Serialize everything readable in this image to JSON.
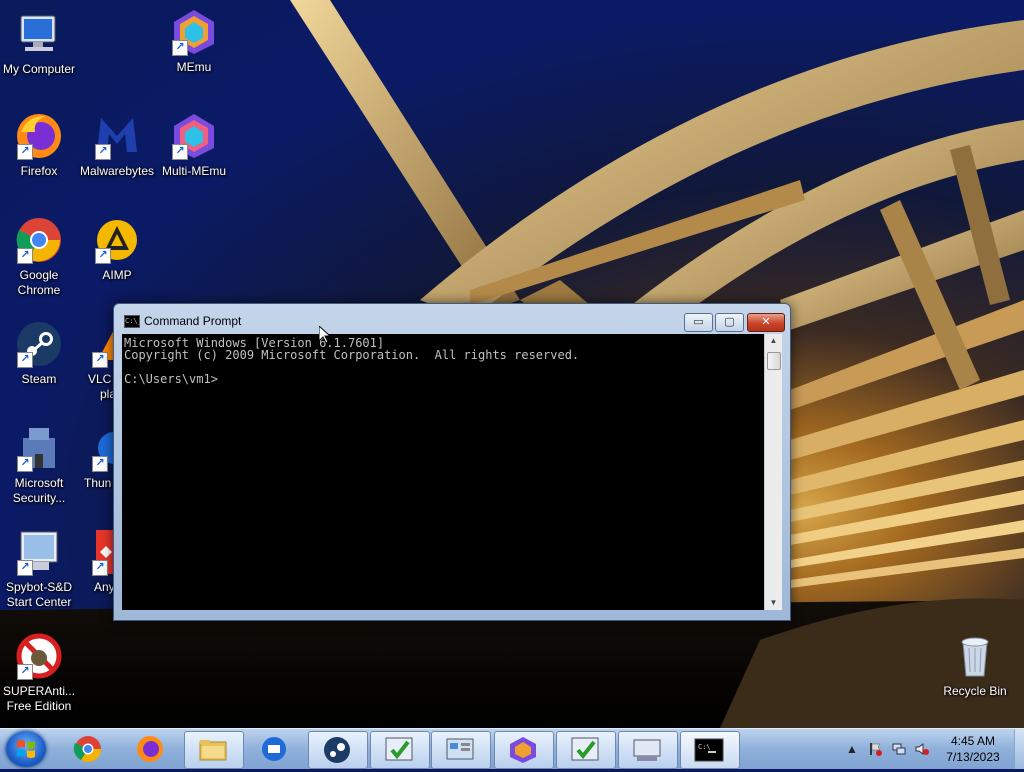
{
  "desktop": {
    "icons": [
      {
        "label": "My Computer",
        "icon": "computer-icon"
      },
      {
        "label": "MEmu",
        "icon": "memu-icon"
      },
      {
        "label": "Firefox",
        "icon": "firefox-icon"
      },
      {
        "label": "Malwarebytes",
        "icon": "malwarebytes-icon"
      },
      {
        "label": "Multi-MEmu",
        "icon": "multi-memu-icon"
      },
      {
        "label": "Google Chrome",
        "icon": "chrome-icon"
      },
      {
        "label": "AIMP",
        "icon": "aimp-icon"
      },
      {
        "label": "Steam",
        "icon": "steam-icon"
      },
      {
        "label": "VLC",
        "label2": "pla",
        "icon": "vlc-icon"
      },
      {
        "label": "Microsoft Security...",
        "icon": "microsoft-security-icon"
      },
      {
        "label": "Thun",
        "icon": "thunderbird-icon"
      },
      {
        "label": "Spybot-S&D Start Center",
        "icon": "spybot-icon"
      },
      {
        "label": "Any",
        "icon": "anydesk-icon"
      },
      {
        "label": "SUPERAnti... Free Edition",
        "icon": "superantispyware-icon"
      },
      {
        "label": "Recycle Bin",
        "icon": "recycle-bin-icon"
      }
    ]
  },
  "cmd": {
    "title": "Command Prompt",
    "icon_text": "C:\\_",
    "min_label": "▭",
    "max_label": "▢",
    "close_label": "✕",
    "lines": [
      "Microsoft Windows [Version 6.1.7601]",
      "Copyright (c) 2009 Microsoft Corporation.  All rights reserved.",
      "",
      "C:\\Users\\vm1>"
    ],
    "scroll_up": "▲",
    "scroll_down": "▼"
  },
  "taskbar": {
    "buttons": [
      {
        "name": "chrome",
        "icon": "chrome-icon",
        "open": false
      },
      {
        "name": "firefox",
        "icon": "firefox-icon",
        "open": false
      },
      {
        "name": "explorer",
        "icon": "folder-icon",
        "open": true
      },
      {
        "name": "thunderbird",
        "icon": "thunderbird-icon",
        "open": false
      },
      {
        "name": "steam",
        "icon": "steam-icon",
        "open": true
      },
      {
        "name": "app-a",
        "icon": "checkmark-app-icon",
        "open": true
      },
      {
        "name": "control-panel",
        "icon": "control-panel-icon",
        "open": true
      },
      {
        "name": "memu",
        "icon": "memu-icon",
        "open": true
      },
      {
        "name": "app-a2",
        "icon": "checkmark-app-icon",
        "open": true
      },
      {
        "name": "on-screen-keyboard",
        "icon": "keyboard-icon",
        "open": true
      },
      {
        "name": "cmd",
        "icon": "cmd-icon",
        "open": true
      }
    ],
    "tray": {
      "expand": "▲",
      "clock_time": "4:45 AM",
      "clock_date": "7/13/2023"
    }
  }
}
